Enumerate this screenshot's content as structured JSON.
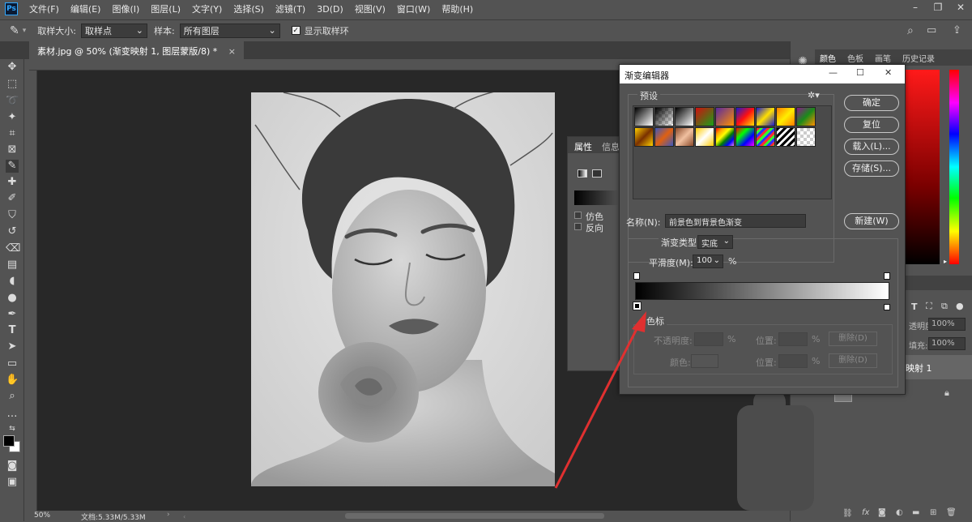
{
  "app": {
    "logo": "Ps",
    "menus": [
      "文件(F)",
      "编辑(E)",
      "图像(I)",
      "图层(L)",
      "文字(Y)",
      "选择(S)",
      "滤镜(T)",
      "3D(D)",
      "视图(V)",
      "窗口(W)",
      "帮助(H)"
    ]
  },
  "options": {
    "sample_size_label": "取样大小:",
    "sample_size_value": "取样点",
    "sample_label": "样本:",
    "sample_value": "所有图层",
    "show_ring_label": "显示取样环"
  },
  "document": {
    "tab_title": "素材.jpg @ 50% (渐变映射 1, 图层蒙版/8) *",
    "zoom": "50%",
    "doc_size": "文档:5.33M/5.33M"
  },
  "right_tabs": [
    "颜色",
    "色板",
    "画笔",
    "历史记录"
  ],
  "layers": {
    "opacity_label": "透明度:",
    "opacity_value": "100%",
    "fill_label": "填充:",
    "fill_value": "100%",
    "layer_name_partial": "映射 1"
  },
  "properties": {
    "tab_properties": "属性",
    "tab_info": "信息",
    "dither_label": "仿色",
    "reverse_label": "反向"
  },
  "dialog": {
    "title": "渐变编辑器",
    "presets_label": "预设",
    "ok": "确定",
    "reset": "复位",
    "load": "载入(L)...",
    "save": "存储(S)...",
    "name_label": "名称(N):",
    "name_value": "前景色到背景色渐变",
    "new": "新建(W)",
    "type_label": "渐变类型:",
    "type_value": "实底",
    "smooth_label": "平滑度(M):",
    "smooth_value": "100",
    "smooth_unit": "%",
    "stops_label": "色标",
    "opacity_label": "不透明度:",
    "opacity_unit": "%",
    "location_label": "位置:",
    "location_unit": "%",
    "delete": "删除(D)",
    "color_label": "颜色:",
    "location_label2": "位置:",
    "location_unit2": "%",
    "delete2": "删除(D)"
  },
  "colors": {
    "ui_bg": "#535353",
    "canvas_bg": "#282828",
    "accent_red": "#e03030"
  }
}
